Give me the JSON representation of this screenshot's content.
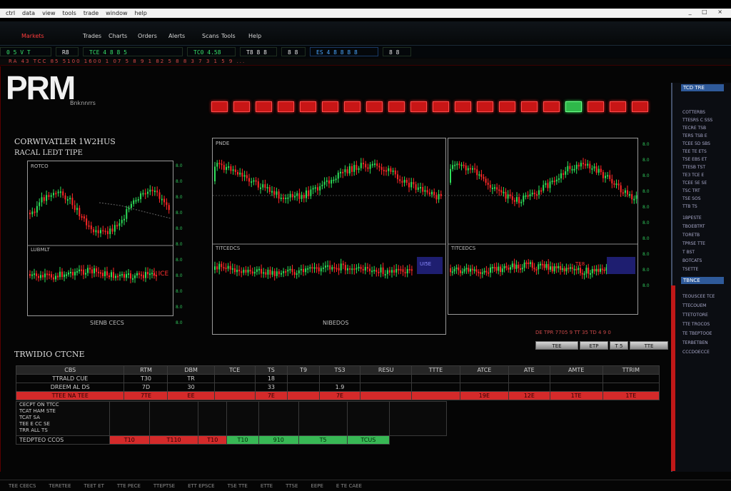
{
  "window": {
    "menu": [
      "ctrl",
      "data",
      "view",
      "tools",
      "trade",
      "window",
      "help"
    ],
    "controls": "_ □ ×"
  },
  "toolbar": {
    "items": [
      {
        "label": "Markets",
        "color": "red"
      },
      {
        "label": "Trades",
        "color": "white"
      },
      {
        "label": "Charts",
        "color": "white"
      },
      {
        "label": "Orders",
        "color": "white"
      },
      {
        "label": "Alerts",
        "color": "white"
      },
      {
        "label": "Scans",
        "color": "white"
      },
      {
        "label": "Tools",
        "color": "white"
      },
      {
        "label": "Help",
        "color": "white"
      }
    ]
  },
  "ticker": [
    {
      "label": "0 5 V T",
      "color": "green"
    },
    {
      "label": "R8",
      "color": "white"
    },
    {
      "label": "TCE 4 8 8 5",
      "color": "green"
    },
    {
      "label": "TC0 4.58",
      "color": "green"
    },
    {
      "label": "T8 8 8",
      "color": "white"
    },
    {
      "label": "8 8",
      "color": "white"
    },
    {
      "label": "ES 4 8 8 8 8",
      "color": "blue"
    },
    {
      "label": "8 8",
      "color": "white"
    }
  ],
  "subticker": "RA 43 TCC 85 5100 1600 1 07 5 8 9 1 82 5 8 8 3 7 3 1 5 9 ...",
  "logo": {
    "text": "PRM",
    "sub": "Bnknnrrs"
  },
  "leds": [
    "red",
    "red",
    "red",
    "red",
    "red",
    "red",
    "red",
    "red",
    "red",
    "red",
    "red",
    "red",
    "red",
    "red",
    "red",
    "red",
    "green",
    "red",
    "red",
    "red"
  ],
  "left_caption": {
    "line1": "CORWIVATLER 1W2HUS",
    "line2": "RACAL LEDT TIPE"
  },
  "panels": {
    "p1": {
      "title": "ROTCO",
      "footer": "SIENB CECS"
    },
    "p2": {
      "title": "PNDE",
      "footer": "NIBEDOS"
    },
    "p3": {
      "title": "",
      "footer": ""
    },
    "lower1": {
      "title": "LUBMLT",
      "tag": "1 ICE"
    },
    "lower2": {
      "title": "TITCEDCS",
      "tag": "UI5E"
    },
    "lower3": {
      "title": "TITCEDCS",
      "tag": "TE8"
    },
    "axis_mid": [
      "8.0",
      "8.0",
      "8.0",
      "8.0",
      "8.0",
      "8.0",
      "8.0",
      "8.0",
      "8.0",
      "8.0",
      "8.0"
    ],
    "axis_right": [
      "8.0",
      "8.0",
      "8.0",
      "8.0",
      "8.0",
      "8.0",
      "8.0",
      "8.0",
      "8.0",
      "8.0"
    ]
  },
  "trade_caption": "TRWIDIO CTCNE",
  "table": {
    "head": [
      "CBS",
      "RTM",
      "DBM",
      "TCE",
      "TS",
      "T9",
      "TS3",
      "RESU",
      "TTTE",
      "ATCE",
      "ATE",
      "AMTE",
      "TTRIM"
    ],
    "row1": [
      "TTRALD CUE",
      "T30",
      "TR",
      "",
      "18",
      "",
      "",
      "",
      "",
      "",
      "",
      "",
      ""
    ],
    "row2": [
      "DREEM AL DS",
      "7D",
      "30",
      "",
      "33",
      "",
      "1.9",
      "",
      "",
      "",
      "",
      "",
      ""
    ],
    "row3": [
      "TTEE NA TEE",
      "7TE",
      "EE",
      "",
      "7E",
      "",
      "7E",
      "",
      "",
      "19E",
      "12E",
      "1TE",
      "1TE"
    ],
    "block": [
      "CECPT ON TTCC",
      "TCAT HAM STE",
      "TCAT SA",
      "TEE E CC SE",
      "TRR ALL TS"
    ],
    "last": [
      "TEDPTEO CCOS",
      "T10",
      "T110",
      "T10",
      "T10",
      "910",
      "T5",
      "TCUS"
    ]
  },
  "controls": {
    "line1": "DE TPR 7705 9  TT 35 TD 4  9 0",
    "buttons": [
      "TEE",
      "ETP",
      "T 5",
      "TTE"
    ]
  },
  "sidebar": {
    "heads": [
      "TCD TRE",
      "TBNCE"
    ],
    "lines1": [
      "COTTERBS",
      "TTESRS C SSS",
      "TECRE TSB",
      "TERS TSB E",
      "TCEE 5D SBS",
      "TEE TE ETS",
      "TSE EBS ET",
      "TTESB TST",
      "TE3 TCE E",
      "TCEE 5E SE",
      "TSC TRT",
      "TSE SOS",
      "TTB TS"
    ],
    "lines2": [
      "1BPESTE",
      "TBOEBTRT",
      "TORETB",
      "TPRSE TTE",
      "T BST",
      "BOTCATS",
      "TSETTE"
    ],
    "lines3": [
      "TEOUSCEE TCE",
      "TTECOUEM",
      "TTETOTORE",
      "TTE TROCOS",
      "TE TBEPTOOE",
      "TERBETBEN",
      "CCCDOECCE"
    ]
  },
  "status": [
    "TEE CEECS",
    "TERETEE",
    "TEET ET",
    "TTE PECE",
    "TTEPTSE",
    "ETT EPSCE",
    "TSE TTE",
    "ETTE",
    "TTSE",
    "EEPE",
    "E TE CAEE"
  ]
}
